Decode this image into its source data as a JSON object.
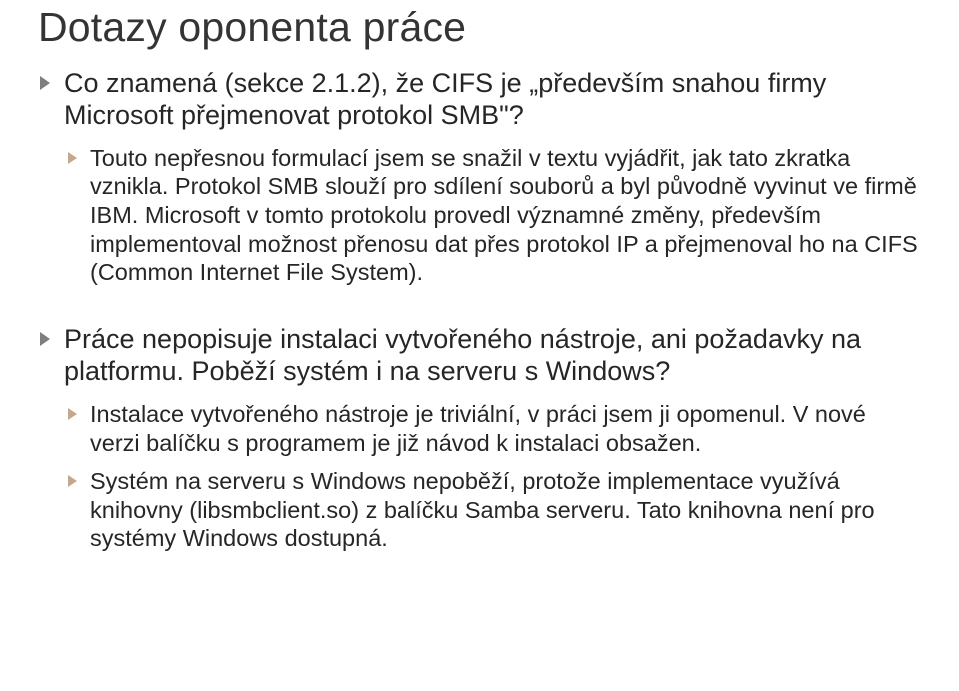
{
  "title": "Dotazy oponenta práce",
  "items": [
    {
      "text": "Co znamená (sekce 2.1.2), že CIFS je „především snahou firmy Microsoft přejmenovat protokol SMB\"?",
      "children": [
        {
          "text": "Touto nepřesnou formulací jsem se snažil v textu vyjádřit, jak tato zkratka vznikla. Protokol SMB slouží pro sdílení souborů a byl původně vyvinut ve firmě IBM. Microsoft v tomto protokolu provedl významné změny, především implementoval možnost přenosu dat přes protokol IP a přejmenoval ho na CIFS (Common Internet File System)."
        }
      ]
    },
    {
      "text": "Práce nepopisuje instalaci vytvořeného nástroje, ani požadavky na platformu. Poběží systém i na serveru s Windows?",
      "children": [
        {
          "text": "Instalace vytvořeného nástroje je triviální, v práci jsem ji opomenul. V nové verzi balíčku s programem je již návod k instalaci obsažen."
        },
        {
          "text": "Systém na serveru s Windows nepoběží, protože implementace využívá knihovny (libsmbclient.so) z balíčku Samba serveru. Tato knihovna není pro systémy Windows dostupná."
        }
      ]
    }
  ]
}
